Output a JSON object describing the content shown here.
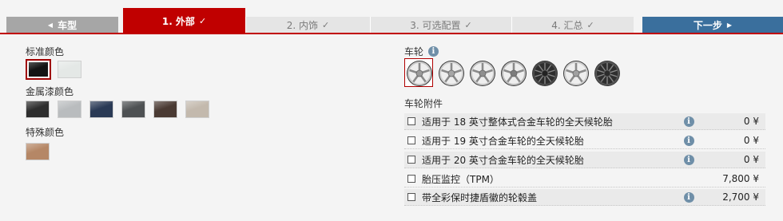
{
  "nav": {
    "back": "车型",
    "tabs": [
      {
        "label": "1. 外部",
        "check": "✓"
      },
      {
        "label": "2. 内饰",
        "check": "✓"
      },
      {
        "label": "3. 可选配置",
        "check": "✓"
      },
      {
        "label": "4. 汇总",
        "check": "✓"
      }
    ],
    "next": "下一步"
  },
  "colors": {
    "standard_title": "标准颜色",
    "standard": [
      "#141414",
      "#e4e8e6"
    ],
    "metallic_title": "金属漆颜色",
    "metallic": [
      "#2d2d2d",
      "#b9bcbe",
      "#2a3a55",
      "#4e5153",
      "#4a3a33",
      "#c3b9ad"
    ],
    "special_title": "特殊颜色",
    "special": [
      "#b58766"
    ]
  },
  "wheels": {
    "title": "车轮",
    "items": [
      "wheel-1",
      "wheel-2",
      "wheel-3",
      "wheel-4",
      "wheel-5",
      "wheel-6",
      "wheel-7"
    ]
  },
  "accessories": {
    "title": "车轮附件",
    "rows": [
      {
        "label": "适用于 18 英寸整体式合金车轮的全天候轮胎",
        "price": "0 ¥",
        "info": true
      },
      {
        "label": "适用于 19 英寸合金车轮的全天候轮胎",
        "price": "0 ¥",
        "info": true
      },
      {
        "label": "适用于 20 英寸合金车轮的全天候轮胎",
        "price": "0 ¥",
        "info": true
      },
      {
        "label": "胎压监控（TPM）",
        "price": "7,800 ¥",
        "info": false
      },
      {
        "label": "带全彩保时捷盾徽的轮毂盖",
        "price": "2,700 ¥",
        "info": true
      }
    ]
  },
  "accent": {
    "red": "#c00000",
    "blue": "#3a6f9d"
  }
}
